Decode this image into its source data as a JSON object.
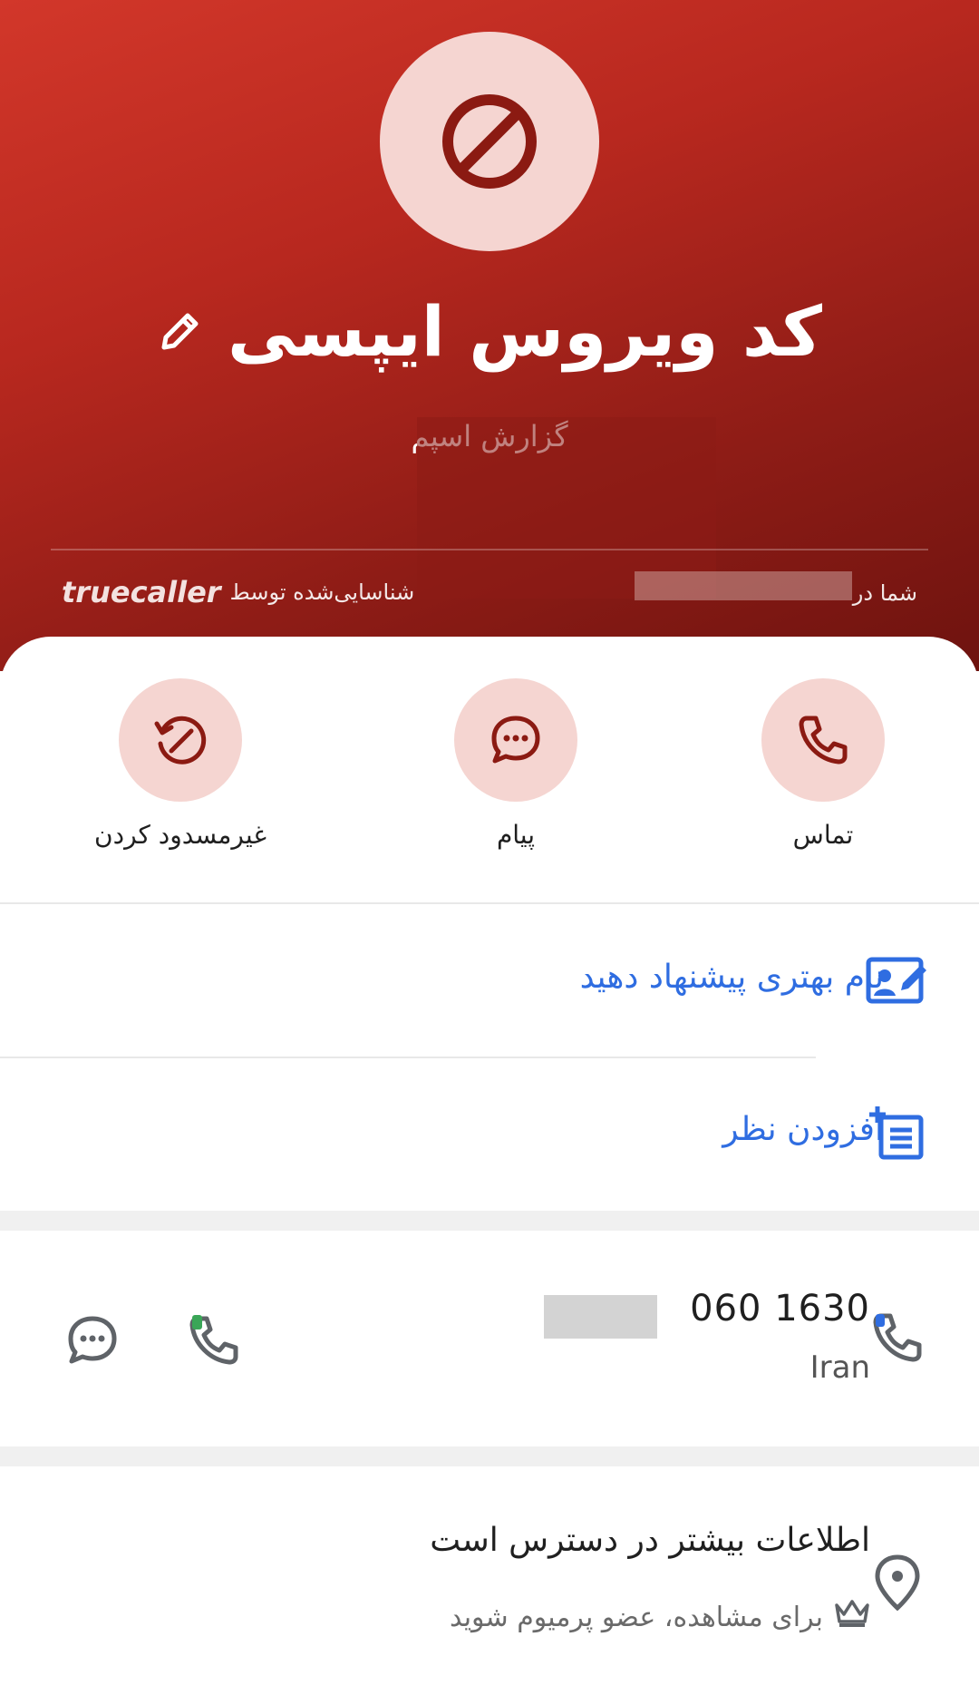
{
  "header": {
    "name": "کد ویروس ایپسی",
    "spam_report": "گزارش اسپم",
    "identified_by": "شناسایی‌شده توسط",
    "brand": "truecaller",
    "location_prefix": "شما در"
  },
  "actions": [
    {
      "label": "تماس",
      "icon": "phone-icon"
    },
    {
      "label": "پیام",
      "icon": "chat-icon"
    },
    {
      "label": "غیرمسدود کردن",
      "icon": "unblock-icon"
    }
  ],
  "suggest_name": {
    "label": "نام بهتری پیشنهاد دهید",
    "icon": "edit-contact-icon"
  },
  "add_comment": {
    "label": "افزودن نظر",
    "icon": "add-note-icon"
  },
  "phone": {
    "number": "060 1630",
    "country": "Iran"
  },
  "more_info": {
    "title": "اطلاعات بیشتر در دسترس است",
    "subtitle": "برای مشاهده، عضو پرمیوم شوید"
  },
  "colors": {
    "header_red": "#b8281f",
    "accent_dark_red": "#8b1a12",
    "pink": "#f5d5d1",
    "link_blue": "#2f6de1"
  }
}
